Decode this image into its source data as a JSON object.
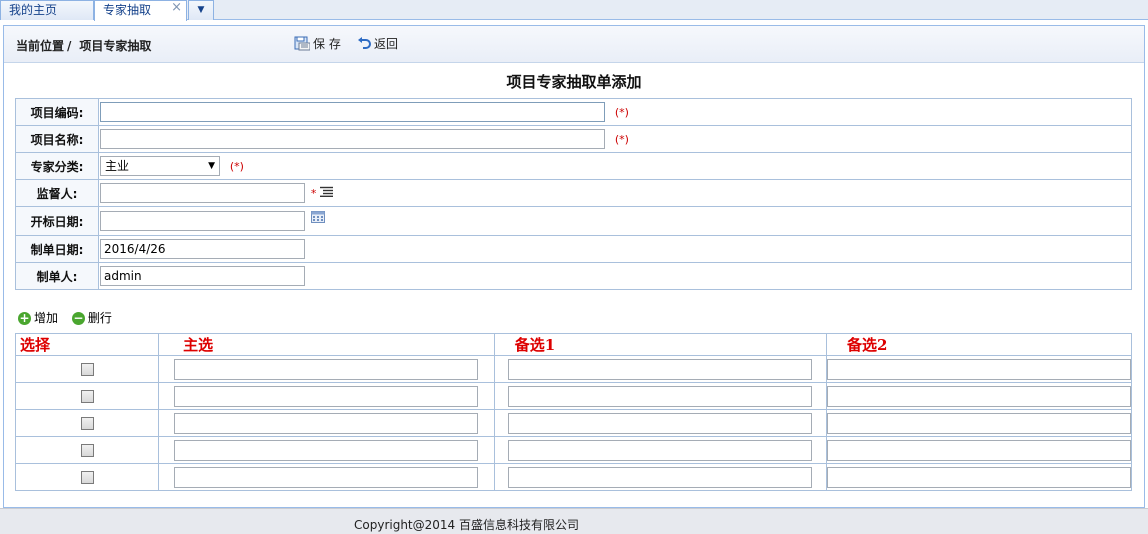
{
  "tabs": [
    {
      "label": "我的主页"
    },
    {
      "label": "专家抽取",
      "close": "×"
    }
  ],
  "tab_menu_icon": "chevron-down-icon",
  "breadcrumb": {
    "prefix": "当前位置",
    "sep": "/",
    "current": "项目专家抽取"
  },
  "toolbar": {
    "save_label": "保 存",
    "back_label": "返回"
  },
  "form": {
    "title": "项目专家抽取单添加",
    "required_mark": "(*)",
    "star": "*",
    "fields": {
      "project_code": {
        "label": "项目编码:",
        "value": ""
      },
      "project_name": {
        "label": "项目名称:",
        "value": ""
      },
      "expert_category": {
        "label": "专家分类:",
        "value": "主业"
      },
      "supervisor": {
        "label": "监督人:",
        "value": ""
      },
      "bid_date": {
        "label": "开标日期:",
        "value": ""
      },
      "create_date": {
        "label": "制单日期:",
        "value": "2016/4/26"
      },
      "creator": {
        "label": "制单人:",
        "value": "admin"
      }
    }
  },
  "grid": {
    "add_label": "增加",
    "delete_label": "删行",
    "columns": [
      "选择",
      "主选",
      "备选1",
      "备选2"
    ],
    "rows": [
      {
        "primary": "",
        "alt1": "",
        "alt2": ""
      },
      {
        "primary": "",
        "alt1": "",
        "alt2": ""
      },
      {
        "primary": "",
        "alt1": "",
        "alt2": ""
      },
      {
        "primary": "",
        "alt1": "",
        "alt2": ""
      },
      {
        "primary": "",
        "alt1": "",
        "alt2": ""
      }
    ]
  },
  "footer": {
    "copyright": "Copyright@2014 百盛信息科技有限公司"
  },
  "colors": {
    "required": "#cc0000",
    "grid_header": "#dd0000",
    "border": "#a9c0dc"
  }
}
